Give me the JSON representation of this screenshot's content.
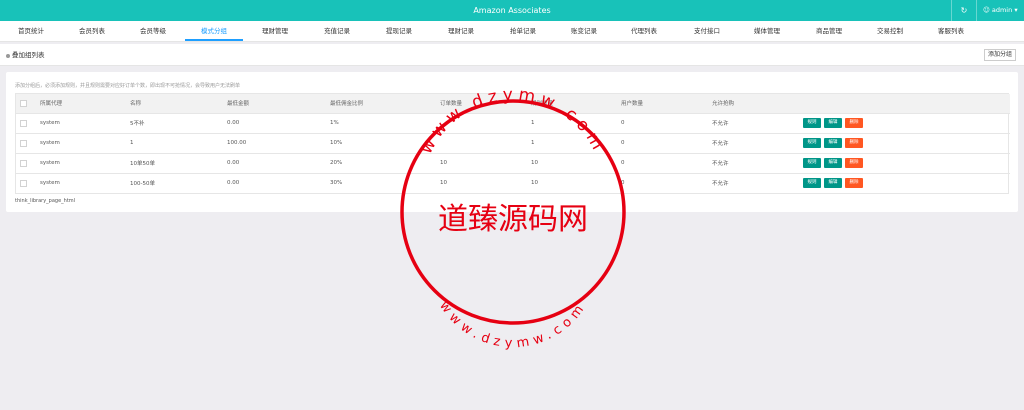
{
  "app": {
    "title": "Amazon Associates",
    "user": "admin",
    "user_icon": "user-icon",
    "refresh_icon": "refresh-icon"
  },
  "nav": {
    "items": [
      {
        "label": "首页统计"
      },
      {
        "label": "会员列表"
      },
      {
        "label": "会员等级"
      },
      {
        "label": "模式分组"
      },
      {
        "label": "理财管理"
      },
      {
        "label": "充值记录"
      },
      {
        "label": "提现记录"
      },
      {
        "label": "理财记录"
      },
      {
        "label": "抢单记录"
      },
      {
        "label": "账变记录"
      },
      {
        "label": "代理列表"
      },
      {
        "label": "支付接口"
      },
      {
        "label": "媒体管理"
      },
      {
        "label": "商品管理"
      },
      {
        "label": "交易控制"
      },
      {
        "label": "客服列表"
      }
    ],
    "active_index": 3
  },
  "toolbar": {
    "breadcrumb": "叠加组列表",
    "add_button": "添加分组"
  },
  "hint": "添加分组后，必须添加规则，并且规则需要对应好订单个数，即出现不可抢情况，会导致用户无法刷单",
  "table": {
    "headers": [
      "",
      "所属代理",
      "名称",
      "最低金额",
      "最低佣金比例",
      "订单数量",
      "规则数量",
      "用户数量",
      "允许抢购",
      ""
    ],
    "rows": [
      {
        "agent": "system",
        "name": "5不补",
        "min_amount": "0.00",
        "min_rate": "1%",
        "orders": "",
        "rules": "1",
        "users": "0",
        "allow": "不允许"
      },
      {
        "agent": "system",
        "name": "1",
        "min_amount": "100.00",
        "min_rate": "10%",
        "orders": "",
        "rules": "1",
        "users": "0",
        "allow": "不允许"
      },
      {
        "agent": "system",
        "name": "10单50单",
        "min_amount": "0.00",
        "min_rate": "20%",
        "orders": "10",
        "rules": "10",
        "users": "0",
        "allow": "不允许"
      },
      {
        "agent": "system",
        "name": "100-50单",
        "min_amount": "0.00",
        "min_rate": "30%",
        "orders": "10",
        "rules": "10",
        "users": "0",
        "allow": "不允许"
      }
    ],
    "actions": {
      "rule": "规则",
      "edit": "编辑",
      "delete": "删除"
    }
  },
  "page_path": "think_library_page_html",
  "watermark": {
    "center_text": "道臻源码网",
    "top_arc": "www.dzymw.com",
    "bottom_arc": "www.dzymw.com",
    "color": "#e60012"
  },
  "colors": {
    "topbar": "#18c2b9",
    "active_tab": "#1e9fff",
    "green_btn": "#009688",
    "orange_btn": "#ff5722"
  }
}
